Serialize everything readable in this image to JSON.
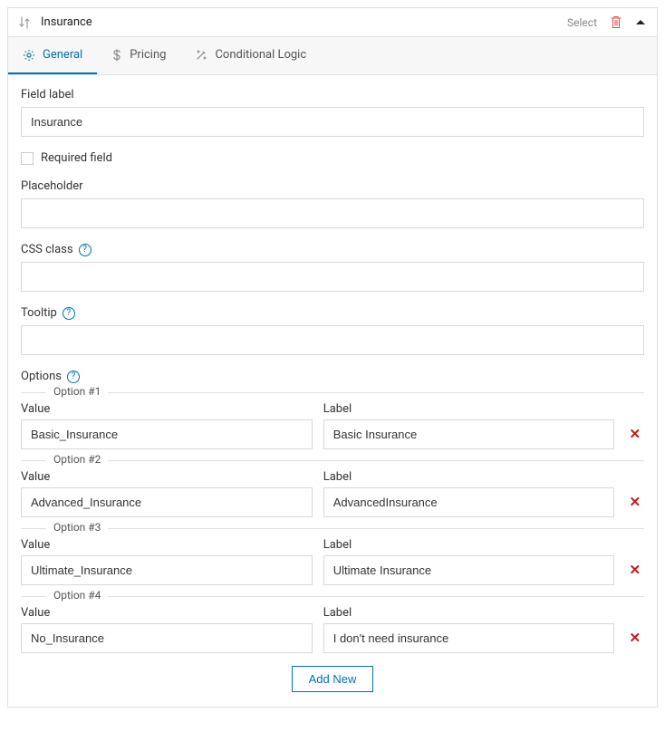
{
  "header": {
    "title": "Insurance",
    "select_label": "Select"
  },
  "tabs": [
    {
      "label": "General",
      "icon": "gear",
      "active": true
    },
    {
      "label": "Pricing",
      "icon": "dollar",
      "active": false
    },
    {
      "label": "Conditional Logic",
      "icon": "wand",
      "active": false
    }
  ],
  "fields": {
    "field_label_label": "Field label",
    "field_label_value": "Insurance",
    "required_label": "Required field",
    "placeholder_label": "Placeholder",
    "placeholder_value": "",
    "css_class_label": "CSS class",
    "css_class_value": "",
    "tooltip_label": "Tooltip",
    "tooltip_value": "",
    "options_label": "Options",
    "value_col_label": "Value",
    "label_col_label": "Label",
    "add_new_label": "Add New"
  },
  "options": [
    {
      "legend": "Option #1",
      "value": "Basic_Insurance",
      "label": "Basic Insurance"
    },
    {
      "legend": "Option #2",
      "value": "Advanced_Insurance",
      "label": "AdvancedInsurance"
    },
    {
      "legend": "Option #3",
      "value": "Ultimate_Insurance",
      "label": "Ultimate Insurance"
    },
    {
      "legend": "Option #4",
      "value": "No_Insurance",
      "label": "I don't need insurance"
    }
  ]
}
